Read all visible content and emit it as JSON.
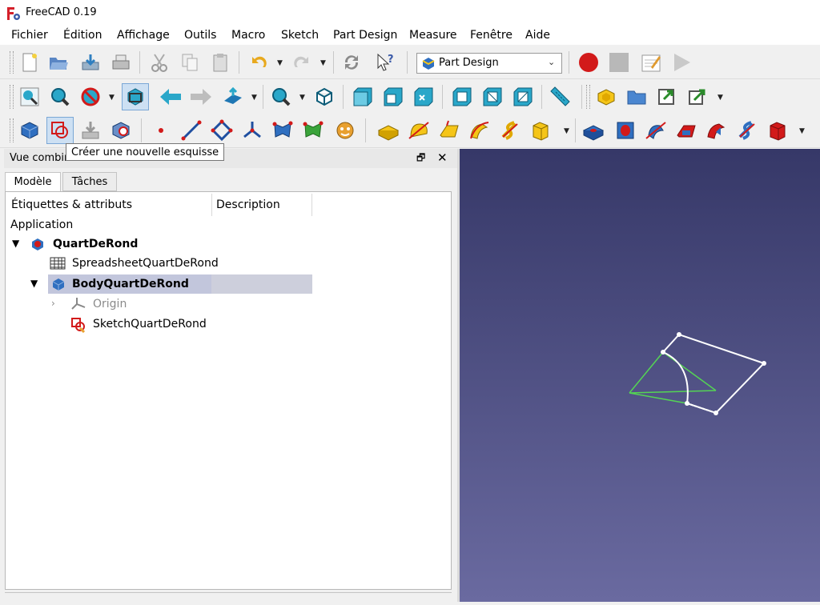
{
  "window": {
    "title": "FreeCAD 0.19"
  },
  "menu": [
    "Fichier",
    "Édition",
    "Affichage",
    "Outils",
    "Macro",
    "Sketch",
    "Part Design",
    "Measure",
    "Fenêtre",
    "Aide"
  ],
  "workbench": {
    "selected": "Part Design"
  },
  "tooltip": {
    "text": "Créer une nouvelle esquisse"
  },
  "panel": {
    "title": "Vue combinée",
    "tabs": [
      "Modèle",
      "Tâches"
    ],
    "columns": [
      "Étiquettes & attributs",
      "Description"
    ],
    "tree": {
      "root": "Application",
      "document": "QuartDeRond",
      "spreadsheet": "SpreadsheetQuartDeRond",
      "body": "BodyQuartDeRond",
      "origin": "Origin",
      "sketch": "SketchQuartDeRond"
    }
  },
  "colors": {
    "view_top": "#363868",
    "view_bottom": "#6a6aa0",
    "sketch_white": "#ffffff",
    "sketch_green": "#54d454",
    "icon_blue": "#1f77b4",
    "icon_teal": "#2aa7c9",
    "icon_red": "#d21a1a",
    "selection": "#cdcfdc"
  },
  "icons": {
    "record": "record-macro-icon",
    "stop": "stop-macro-icon",
    "play": "play-macro-icon"
  }
}
